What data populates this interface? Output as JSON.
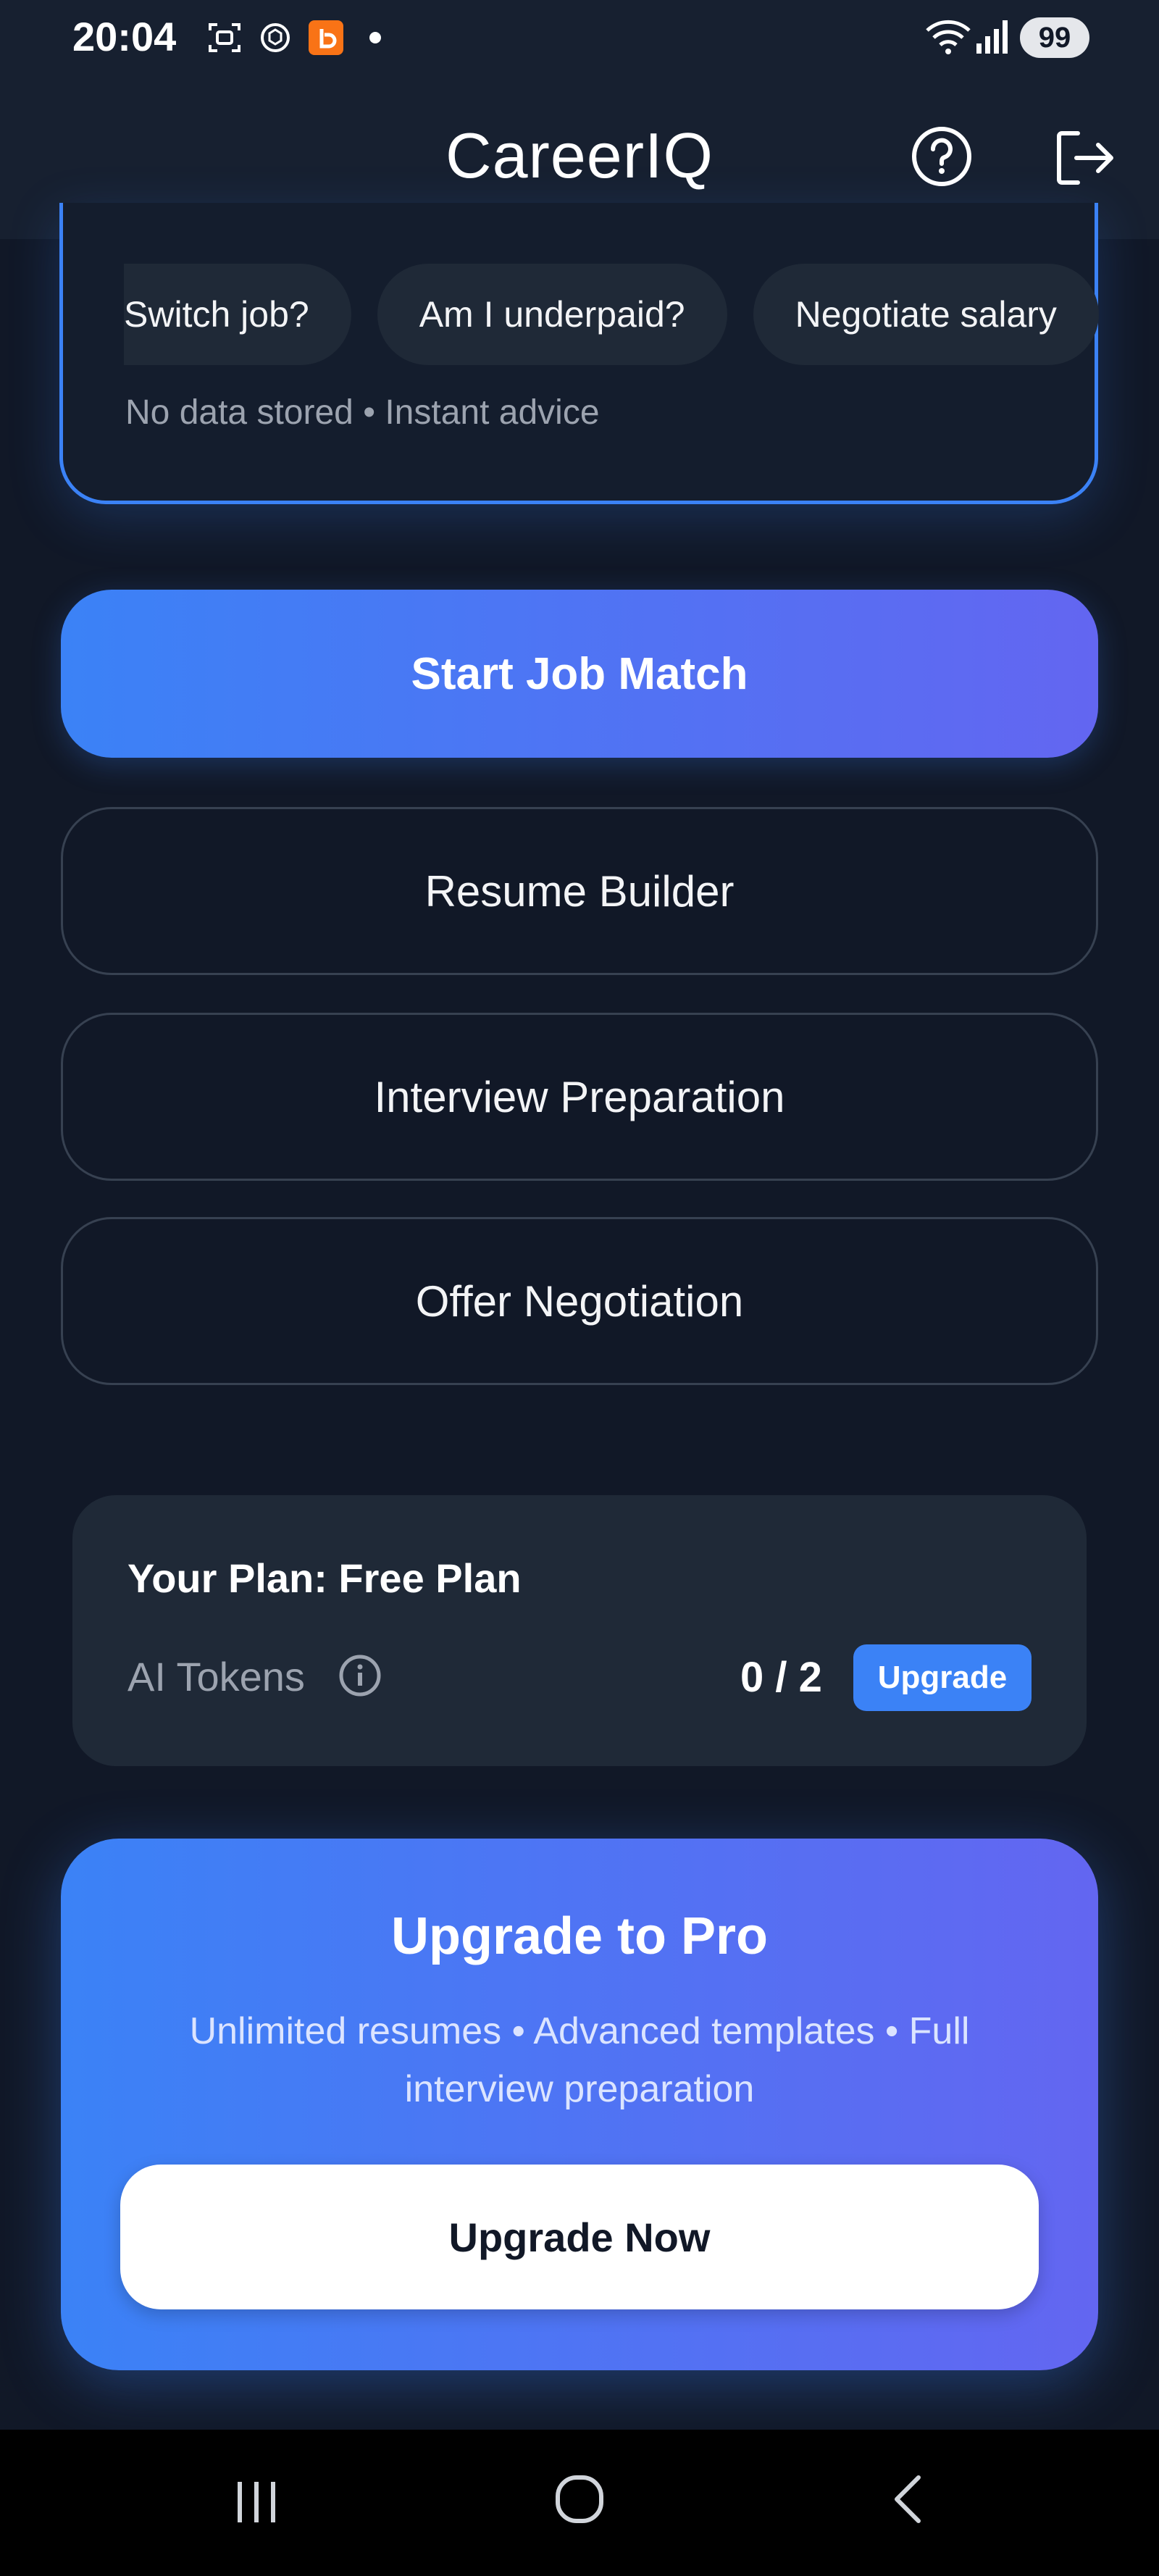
{
  "status_bar": {
    "time": "20:04",
    "battery": "99",
    "icons": [
      "screenshot-icon",
      "chatgpt-icon",
      "app-notification-icon",
      "wifi-icon",
      "signal-icon"
    ]
  },
  "header": {
    "title": "CareerIQ",
    "help_icon": "help-circle-icon",
    "logout_icon": "logout-icon"
  },
  "chat_card": {
    "chips": [
      "Switch job?",
      "Am I underpaid?",
      "Negotiate salary"
    ],
    "privacy_note": "No data stored • Instant advice"
  },
  "actions": {
    "primary": "Start Job Match",
    "resume": "Resume Builder",
    "interview": "Interview Preparation",
    "offer": "Offer Negotiation"
  },
  "plan": {
    "title": "Your Plan: Free Plan",
    "tokens_label": "AI Tokens",
    "tokens_count": "0 / 2",
    "upgrade_label": "Upgrade"
  },
  "pro": {
    "title": "Upgrade to Pro",
    "description": "Unlimited resumes • Advanced templates • Full interview preparation",
    "button": "Upgrade Now"
  },
  "colors": {
    "background": "#111827",
    "accent_blue": "#3b82f6",
    "accent_indigo": "#6366f1",
    "card": "#1f2937"
  }
}
